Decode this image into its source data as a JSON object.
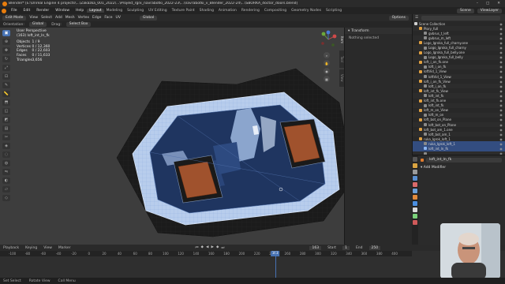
{
  "titlebar": {
    "text": "Blender* [E:\\Unreal Engine 4 projects\\...\\Zakázka_001_2022\\...\\Projekt_rgrx_navrabotki_2022-23\\...\\navrabotki_v_Blender_2022-24\\...\\SBORKA_doctor_doors.blend]",
    "controls": [
      "–",
      "□",
      "✕"
    ]
  },
  "menu": {
    "items": [
      "File",
      "Edit",
      "Render",
      "Window",
      "Help"
    ]
  },
  "workspaces": [
    "Layout",
    "Modeling",
    "Sculpting",
    "UV Editing",
    "Texture Paint",
    "Shading",
    "Animation",
    "Rendering",
    "Compositing",
    "Geometry Nodes",
    "Scripting"
  ],
  "workspace_active": "Layout",
  "scene": {
    "label": "Scene",
    "view_layer": "ViewLayer"
  },
  "header": {
    "mode": "Edit Mode",
    "menus": [
      "View",
      "Select",
      "Add",
      "Mesh",
      "Vertex",
      "Edge",
      "Face",
      "UV"
    ],
    "transform_orientation": "Global",
    "pivot": "Options"
  },
  "subheader": {
    "orientation_label": "Orientation:",
    "orientation": "Global",
    "drag_label": "Drag:",
    "drag": "Select Box"
  },
  "overlay": {
    "view_name": "User Perspective",
    "object_name": "(163) loft_int_ln_fk",
    "stats": [
      {
        "label": "Objects",
        "value": "1 / 9"
      },
      {
        "label": "Vertices",
        "value": "0 / 12,360"
      },
      {
        "label": "Edges",
        "value": "0 / 22,603"
      },
      {
        "label": "Faces",
        "value": "0 / 11,633"
      },
      {
        "label": "Triangles",
        "value": "3,656"
      }
    ]
  },
  "npanel": {
    "title": "Transform",
    "body": "Nothing selected",
    "tabs": [
      "Item",
      "Tool",
      "View"
    ]
  },
  "outliner": {
    "search_placeholder": "",
    "rows": [
      {
        "label": "Scene Collection",
        "color": "#cfcfcf",
        "sel": false
      },
      {
        "label": "Plory_full",
        "color": "#e0a040",
        "sel": false
      },
      {
        "label": "gvbrus_t_left",
        "color": "#8a8a8a",
        "sel": false
      },
      {
        "label": "gvbrus_m_left",
        "color": "#8a8a8a",
        "sel": false
      },
      {
        "label": "Logo_Igroka_full_charny.one",
        "color": "#e0a040",
        "sel": false
      },
      {
        "label": "Logo_Igroka_full_charny",
        "color": "#8a8a8a",
        "sel": false
      },
      {
        "label": "Logo_Igroka_full_belly.one",
        "color": "#e0a040",
        "sel": false
      },
      {
        "label": "Logo_Igroka_full_belly",
        "color": "#8a8a8a",
        "sel": false
      },
      {
        "label": "loft_i_on_fk.one",
        "color": "#e0a040",
        "sel": false
      },
      {
        "label": "loft_i_on_fk",
        "color": "#8a8a8a",
        "sel": false
      },
      {
        "label": "loftVid_1_View",
        "color": "#e0a040",
        "sel": false
      },
      {
        "label": "loftVid_1_View",
        "color": "#8a8a8a",
        "sel": false
      },
      {
        "label": "loft_i_on_fk_View",
        "color": "#e0a040",
        "sel": false
      },
      {
        "label": "loft_i_on_fk",
        "color": "#8a8a8a",
        "sel": false
      },
      {
        "label": "loft_int_fk_View",
        "color": "#e0a040",
        "sel": false
      },
      {
        "label": "loft_int_fk",
        "color": "#8a8a8a",
        "sel": false
      },
      {
        "label": "loft_int_fk.one",
        "color": "#e0a040",
        "sel": false
      },
      {
        "label": "loft_int_fk",
        "color": "#8a8a8a",
        "sel": false
      },
      {
        "label": "loft_m_on_View",
        "color": "#e0a040",
        "sel": false
      },
      {
        "label": "loft_m_on",
        "color": "#8a8a8a",
        "sel": false
      },
      {
        "label": "loft_bot_on_Plane",
        "color": "#e0a040",
        "sel": false
      },
      {
        "label": "loft_bot_on_Plane",
        "color": "#8a8a8a",
        "sel": false
      },
      {
        "label": "loft_bot_am_1.one",
        "color": "#e0a040",
        "sel": false
      },
      {
        "label": "loft_bot_am_1",
        "color": "#8a8a8a",
        "sel": false
      },
      {
        "label": "ruka_Igrok_loft_1",
        "color": "#e0a040",
        "sel": false
      },
      {
        "label": "ruka_Igrok_loft_1",
        "color": "#8a8a8a",
        "sel": true
      },
      {
        "label": "loft_int_ln_fk",
        "color": "#8ab4f0",
        "sel": true
      },
      {
        "label": "",
        "color": "#8a8a8a",
        "sel": false
      }
    ]
  },
  "properties": {
    "object_label": "loft_int_ln_fk",
    "add_modifier": "Add Modifier"
  },
  "timeline": {
    "menus": [
      "Playback",
      "Keying",
      "View",
      "Marker"
    ],
    "current_frame": "163",
    "start_label": "Start",
    "start": "1",
    "end_label": "End",
    "end": "250",
    "ticks": [
      {
        "label": "-100",
        "frac": 0.03
      },
      {
        "label": "-80",
        "frac": 0.067
      },
      {
        "label": "-60",
        "frac": 0.105
      },
      {
        "label": "-40",
        "frac": 0.142
      },
      {
        "label": "-20",
        "frac": 0.179
      },
      {
        "label": "0",
        "frac": 0.216
      },
      {
        "label": "20",
        "frac": 0.253
      },
      {
        "label": "40",
        "frac": 0.29
      },
      {
        "label": "60",
        "frac": 0.328
      },
      {
        "label": "80",
        "frac": 0.365
      },
      {
        "label": "100",
        "frac": 0.402
      },
      {
        "label": "120",
        "frac": 0.439
      },
      {
        "label": "140",
        "frac": 0.476
      },
      {
        "label": "160",
        "frac": 0.513
      },
      {
        "label": "180",
        "frac": 0.55
      },
      {
        "label": "200",
        "frac": 0.587
      },
      {
        "label": "220",
        "frac": 0.624
      },
      {
        "label": "240",
        "frac": 0.661
      },
      {
        "label": "260",
        "frac": 0.698
      },
      {
        "label": "280",
        "frac": 0.735
      },
      {
        "label": "300",
        "frac": 0.772
      },
      {
        "label": "320",
        "frac": 0.81
      },
      {
        "label": "340",
        "frac": 0.847
      },
      {
        "label": "360",
        "frac": 0.884
      },
      {
        "label": "380",
        "frac": 0.921
      },
      {
        "label": "400",
        "frac": 0.958
      }
    ],
    "playhead_frac": 0.668
  },
  "status": {
    "items": [
      "Set Select",
      "Rotate View",
      "Call Menu"
    ]
  },
  "colors": {
    "accent": "#4772b3",
    "mesh_face": "#1f3560",
    "mesh_edge": "#c8d8f0",
    "orange_face": "#a0522d"
  }
}
